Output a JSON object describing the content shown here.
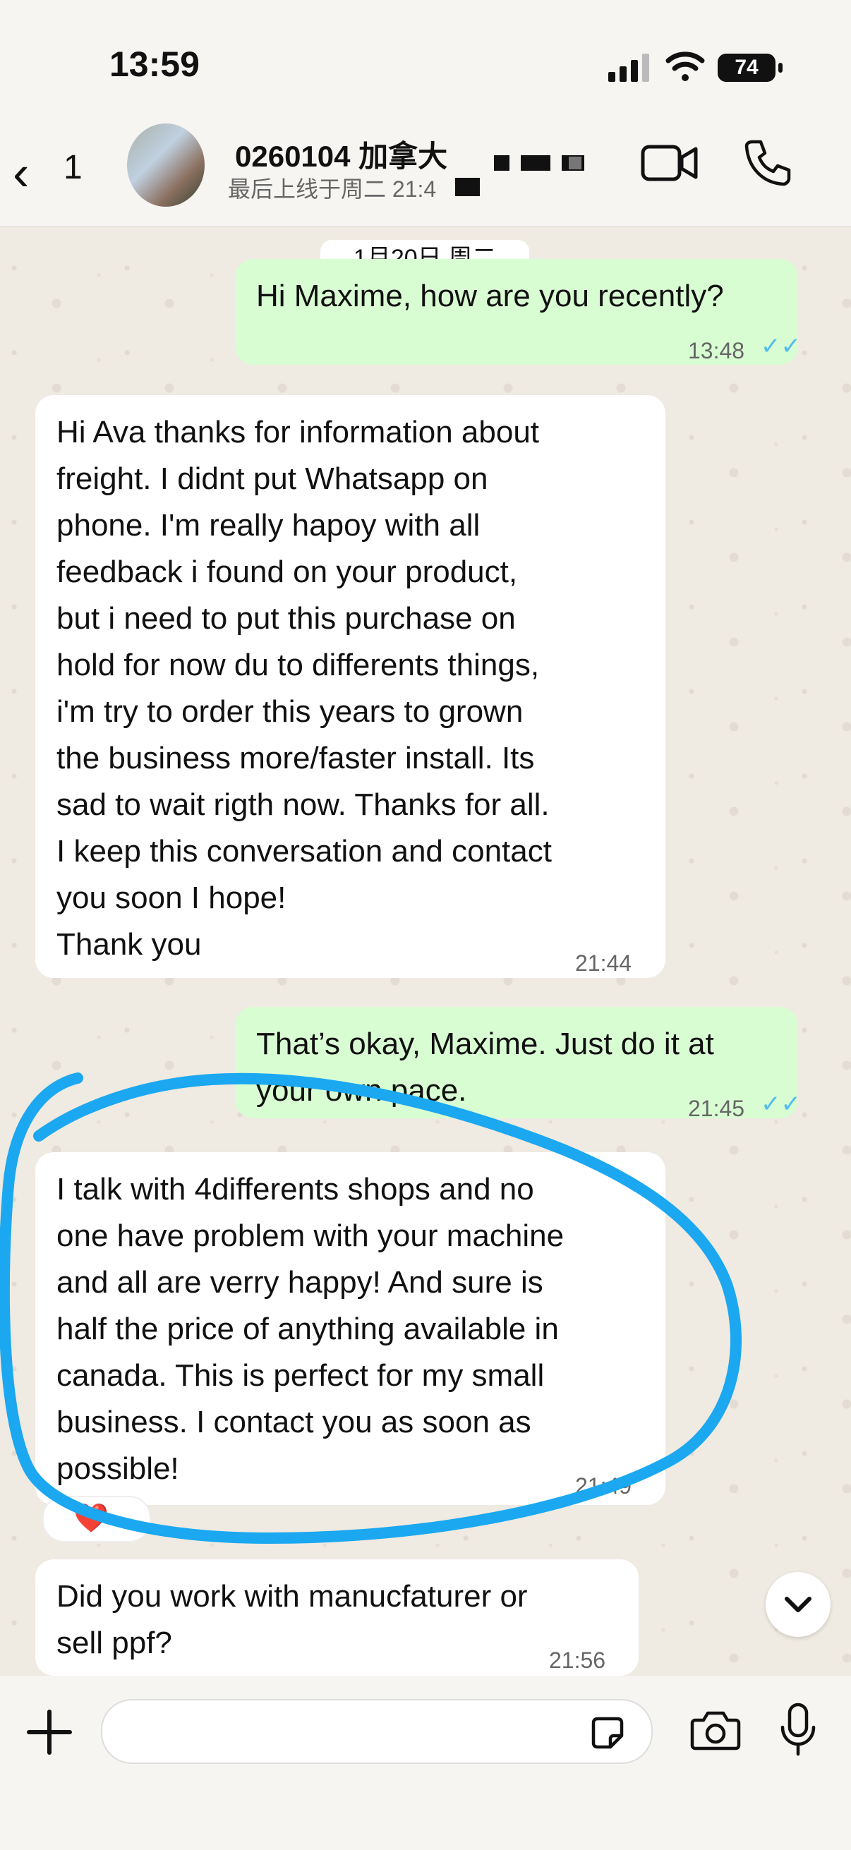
{
  "status_bar": {
    "time": "13:59",
    "battery": "74"
  },
  "header": {
    "back_count": "1",
    "contact_name": "0260104 加拿大",
    "last_seen": "最后上线于周二 21:4"
  },
  "date_divider": "1月20日 周二",
  "messages": [
    {
      "dir": "out",
      "text": "Hi Maxime, how are you recently?",
      "time": "13:48",
      "status": "read"
    },
    {
      "dir": "in",
      "text": "Hi Ava thanks for information about\nfreight. I didnt put Whatsapp on\nphone. I'm really hapoy with all\nfeedback i found on your product,\nbut i need to put this purchase on\nhold for now du to differents things,\ni'm try to order this years to grown\nthe business more/faster install. Its\nsad to wait rigth now. Thanks for all.\nI keep this conversation and contact\nyou soon I hope!\nThank you",
      "time": "21:44"
    },
    {
      "dir": "out",
      "text": "That’s okay, Maxime. Just do it at\nyour own pace.",
      "time": "21:45",
      "status": "read"
    },
    {
      "dir": "in",
      "text": "I talk with 4differents shops and no\none have problem with your machine\nand all are verry happy! And sure is\nhalf the price of anything available in\ncanada. This is perfect for my small\nbusiness. I contact you as soon as\npossible!",
      "time": "21:49",
      "reaction": "❤️"
    },
    {
      "dir": "in",
      "text": "Did you work with manucfaturer or\nsell ppf?",
      "time": "21:56"
    }
  ],
  "icons": {
    "back": "chevron-left-icon",
    "video": "video-call-icon",
    "phone": "phone-call-icon",
    "scroll": "chevron-down-icon",
    "attach": "plus-icon",
    "sticker": "sticker-icon",
    "camera": "camera-icon",
    "mic": "microphone-icon"
  },
  "colors": {
    "outgoing_bubble": "#d9fdd3",
    "incoming_bubble": "#ffffff",
    "read_ticks": "#53bdeb",
    "annotation": "#1ba8f0"
  }
}
